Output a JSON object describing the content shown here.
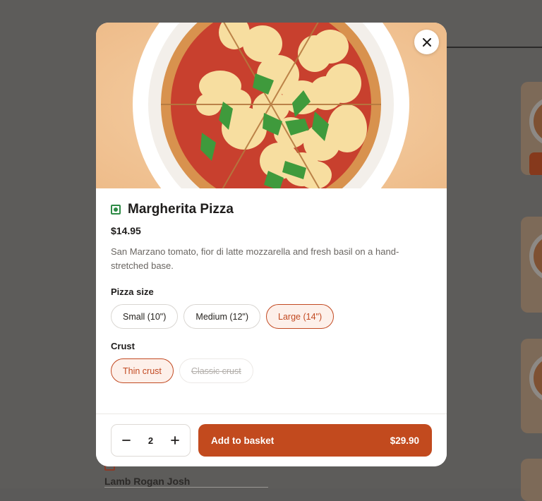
{
  "background": {
    "next_item_name": "Lamb Rogan Josh"
  },
  "modal": {
    "close_icon": "close-icon",
    "hero_image": "margherita-pizza-photo",
    "item": {
      "name": "Margherita Pizza",
      "veg_indicator": "veg-icon",
      "price": "$14.95",
      "description": "San Marzano tomato, fior di latte mozzarella and fresh basil on a hand-stretched base."
    },
    "size": {
      "label": "Pizza size",
      "options": [
        {
          "label": "Small (10\")",
          "state": "default"
        },
        {
          "label": "Medium (12\")",
          "state": "default"
        },
        {
          "label": "Large (14\")",
          "state": "selected"
        }
      ]
    },
    "crust": {
      "label": "Crust",
      "options": [
        {
          "label": "Thin crust",
          "state": "selected"
        },
        {
          "label": "Classic crust",
          "state": "disabled"
        }
      ]
    },
    "footer": {
      "quantity": "2",
      "decrement_icon": "minus-icon",
      "increment_icon": "plus-icon",
      "add_label": "Add to basket",
      "total": "$29.90"
    }
  },
  "colors": {
    "accent": "#c24a1e",
    "veg": "#2e8b46",
    "overlay": "#5d5c5a"
  }
}
